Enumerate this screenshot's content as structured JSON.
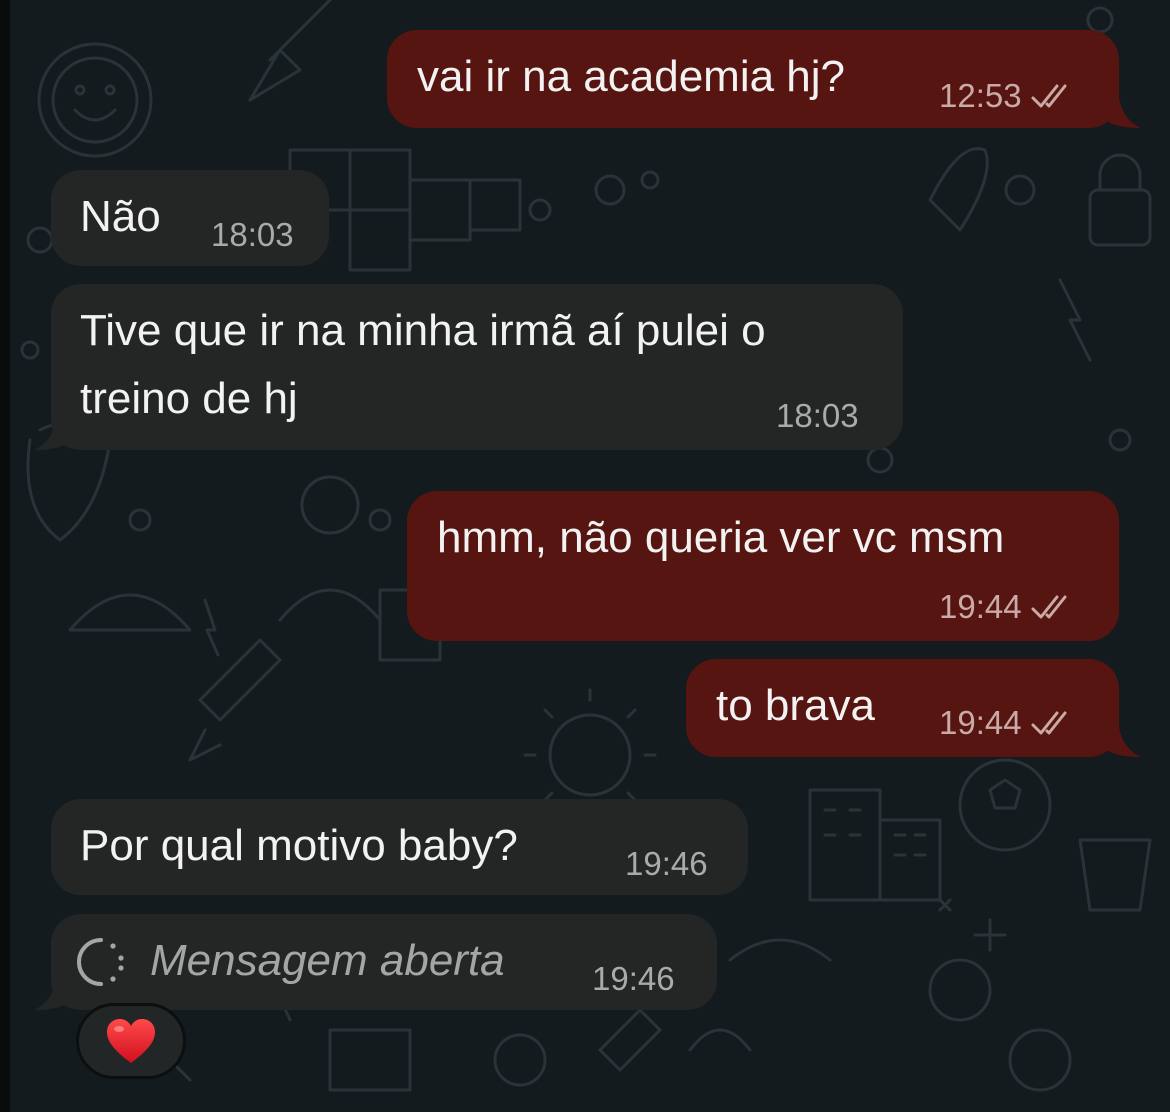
{
  "messages": [
    {
      "dir": "out",
      "text": "vai ir na academia hj?",
      "time": "12:53",
      "status": "read"
    },
    {
      "dir": "in",
      "text": "Não",
      "time": "18:03"
    },
    {
      "dir": "in",
      "lines": [
        "Tive que ir na minha irmã aí pulei o",
        "treino de hj"
      ],
      "time": "18:03"
    },
    {
      "dir": "out",
      "text": "hmm, não queria ver vc msm",
      "time": "19:44",
      "status": "read"
    },
    {
      "dir": "out",
      "text": "to brava",
      "time": "19:44",
      "status": "read"
    },
    {
      "dir": "in",
      "text": "Por qual motivo baby?",
      "time": "19:46"
    },
    {
      "dir": "in",
      "type": "view-once-opened",
      "text": "Mensagem aberta",
      "time": "19:46",
      "icon": "view-once-opened-icon"
    }
  ],
  "reaction": {
    "emoji": "❤️",
    "icon": "red-heart-icon"
  },
  "colors": {
    "background": "#141b1e",
    "outgoing_bubble": "#561510",
    "incoming_bubble": "#242626",
    "read_ticks": "#c9aaa6"
  }
}
